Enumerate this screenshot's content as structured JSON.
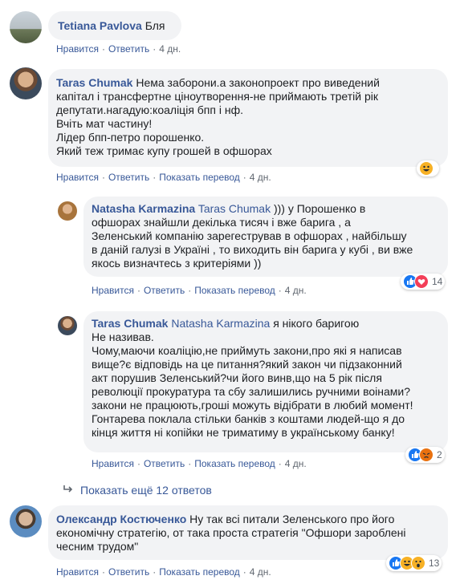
{
  "comments": [
    {
      "name": "Tetiana Pavlova",
      "text": "Бля",
      "actions": {
        "like": "Нравится",
        "reply": "Ответить",
        "time": "4 дн."
      }
    },
    {
      "name": "Taras Chumak",
      "lines": [
        "Нема заборони.а законопроект про виведений",
        "капітал і трансфертне ціноутворення-не приймають третій рік",
        "депутати.нагадую:коаліція бпп і нф.",
        "Вчіть мат частину!",
        "Лідер бпп-петро порошенко.",
        "Який теж тримає купу грошей в офшорах"
      ],
      "actions": {
        "like": "Нравится",
        "reply": "Ответить",
        "translate": "Показать перевод",
        "time": "4 дн."
      },
      "reactions": {
        "icons": [
          "haha-icon"
        ],
        "count": ""
      }
    },
    {
      "name": "Natasha Karmazina",
      "mention": "Taras Chumak",
      "first_line": ")))  у Порошенко в",
      "lines": [
        "офшорах знайшли декілька тисяч і вже барига , а",
        "Зеленський компанію зарегестрував в офшорах , найбільшу",
        "в даній галузі в Україні , то виходить він барига у кубі , ви вже",
        "якось визначтесь з критеріями ))"
      ],
      "actions": {
        "like": "Нравится",
        "reply": "Ответить",
        "translate": "Показать перевод",
        "time": "4 дн."
      },
      "reactions": {
        "icons": [
          "like-icon",
          "love-icon"
        ],
        "count": "14"
      }
    },
    {
      "name": "Taras Chumak",
      "mention": "Natasha Karmazina",
      "first_line": "я нікого баригою",
      "lines": [
        "Не називав.",
        "Чому,маючи коаліцію,не приймуть закони,про які я написав",
        "вище?є відповідь на це питання?який закон чи підзаконний",
        "акт порушив Зеленський?чи його винв,що на 5 рік після",
        "революції прокуратура та сбу залишились ручними воінами?",
        "закони не працюють,гроші можуть відібрати в любий момент!",
        "Гонтарева поклала стільки банків з коштами людей-що я до",
        "кінця життя ні копійки не триматиму в українському банку!"
      ],
      "actions": {
        "like": "Нравится",
        "reply": "Ответить",
        "translate": "Показать перевод",
        "time": "4 дн."
      },
      "reactions": {
        "icons": [
          "like-icon",
          "angry-icon"
        ],
        "count": "2"
      }
    },
    {
      "name": "Олександр Костюченко",
      "first_line": "Ну так всі питали Зеленського про його",
      "lines": [
        "економічну стратегію, от така проста стратегія \"Офшори зароблені",
        "чесним трудом\""
      ],
      "actions": {
        "like": "Нравится",
        "reply": "Ответить",
        "translate": "Показать перевод",
        "time": "4 дн."
      },
      "reactions": {
        "icons": [
          "like-icon",
          "haha-icon",
          "wow-icon"
        ],
        "count": "13"
      }
    }
  ],
  "more_replies": "Показать ещё 12 ответов",
  "colors": {
    "link": "#385898",
    "bubble": "#f2f3f5",
    "meta": "#606770",
    "like": "#1877f2"
  }
}
